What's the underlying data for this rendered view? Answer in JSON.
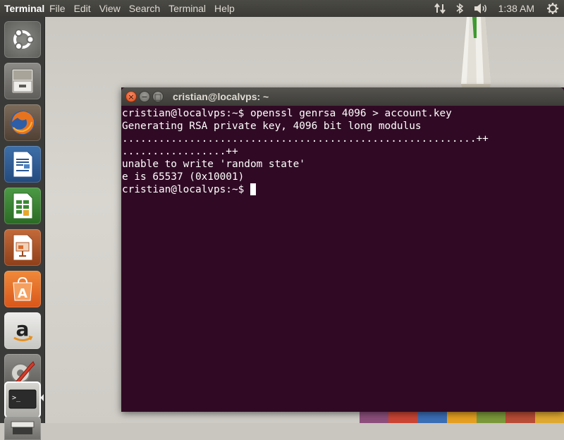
{
  "top_panel": {
    "app_title": "Terminal",
    "menu": [
      "File",
      "Edit",
      "View",
      "Search",
      "Terminal",
      "Help"
    ],
    "clock": "1:38 AM",
    "indicator_icons": [
      "network-updown-icon",
      "bluetooth-icon",
      "volume-icon",
      "power-settings-icon"
    ]
  },
  "launcher": {
    "items": [
      {
        "name": "ubuntu-dash",
        "icon": "ubuntu-logo-icon"
      },
      {
        "name": "files",
        "icon": "file-cabinet-icon"
      },
      {
        "name": "firefox",
        "icon": "firefox-icon"
      },
      {
        "name": "libreoffice-writer",
        "icon": "writer-document-icon"
      },
      {
        "name": "libreoffice-calc",
        "icon": "calc-spreadsheet-icon"
      },
      {
        "name": "libreoffice-impress",
        "icon": "impress-presentation-icon"
      },
      {
        "name": "ubuntu-software-center",
        "icon": "software-bag-icon"
      },
      {
        "name": "amazon",
        "icon": "amazon-icon"
      },
      {
        "name": "system-settings",
        "icon": "settings-wrench-icon"
      },
      {
        "name": "terminal",
        "icon": "terminal-prompt-icon",
        "running": true
      },
      {
        "name": "scanner",
        "icon": "scanner-icon"
      }
    ]
  },
  "terminal": {
    "title": "cristian@localvps: ~",
    "lines": [
      "cristian@localvps:~$ openssl genrsa 4096 > account.key",
      "Generating RSA private key, 4096 bit long modulus",
      "..........................................................++",
      ".................++",
      "unable to write 'random state'",
      "e is 65537 (0x10001)",
      "cristian@localvps:~$ "
    ],
    "close_glyph": "×",
    "min_glyph": "−",
    "max_glyph": "□"
  },
  "colors": {
    "terminal_bg": "#300a24",
    "panel_bg": "#3b3a36",
    "launcher_bg": "#3a3a38",
    "close_button": "#df4a16"
  }
}
